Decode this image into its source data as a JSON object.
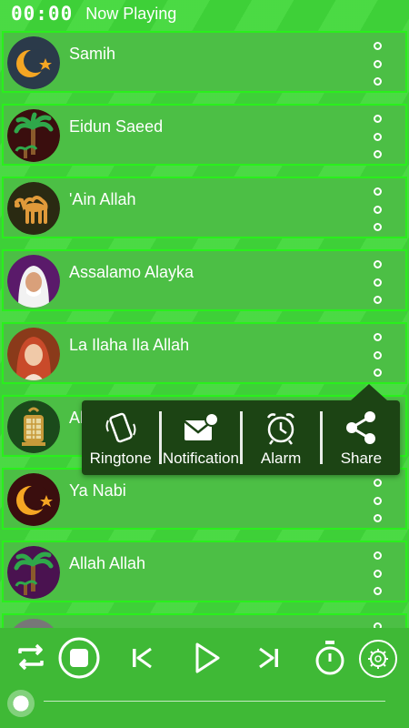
{
  "header": {
    "timer": "00:00",
    "title": "Now Playing"
  },
  "tracks": [
    {
      "title": "Samih",
      "icon": "crescent-moon-icon"
    },
    {
      "title": "Eidun Saeed",
      "icon": "palm-tree-icon"
    },
    {
      "title": "'Ain Allah",
      "icon": "camel-icon"
    },
    {
      "title": "Assalamo Alayka",
      "icon": "sheikh-portrait-icon"
    },
    {
      "title": "La Ilaha Ila Allah",
      "icon": "hijab-woman-icon"
    },
    {
      "title": "Al",
      "icon": "lantern-icon"
    },
    {
      "title": "Ya Nabi",
      "icon": "crescent-moon-icon"
    },
    {
      "title": "Allah Allah",
      "icon": "palm-tree-icon"
    }
  ],
  "popup": {
    "ringtone": "Ringtone",
    "notification": "Notification",
    "alarm": "Alarm",
    "share": "Share"
  },
  "colors": {
    "background": "#41d83a",
    "row_border": "#29f01c",
    "popup_bg": "#1c4414"
  }
}
